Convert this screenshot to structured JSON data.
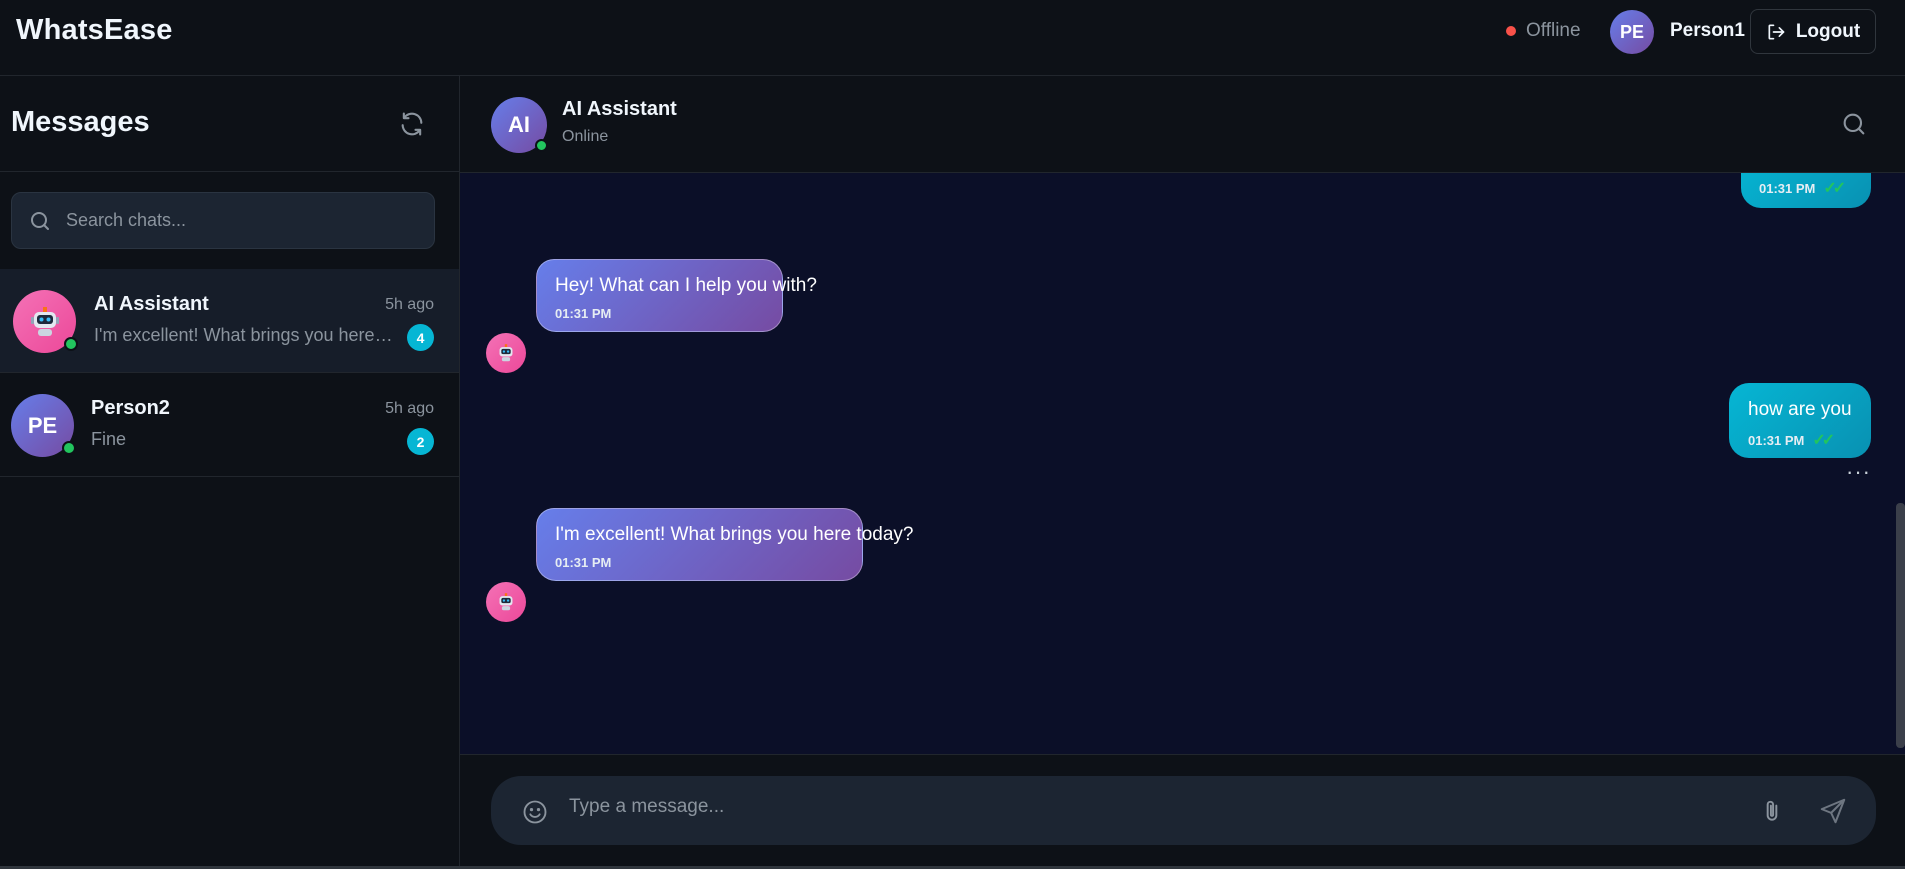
{
  "app": {
    "title": "WhatsEase"
  },
  "header": {
    "status_label": "Offline",
    "status_color": "#f85149",
    "user_initials": "PE",
    "user_name": "Person1",
    "logout_label": "Logout"
  },
  "sidebar": {
    "title": "Messages",
    "search_placeholder": "Search chats...",
    "chats": [
      {
        "name": "AI Assistant",
        "time": "5h ago",
        "preview": "I'm excellent! What brings you here today?",
        "unread": "4",
        "avatar": "robot-icon",
        "online": true,
        "active": true
      },
      {
        "name": "Person2",
        "time": "5h ago",
        "preview": "Fine",
        "unread": "2",
        "avatar_initials": "PE",
        "online": true,
        "active": false
      }
    ]
  },
  "conversation": {
    "contact_initials": "AI",
    "contact_name": "AI Assistant",
    "contact_status": "Online",
    "messages": [
      {
        "direction": "out",
        "text": "",
        "time": "01:31 PM",
        "read": true
      },
      {
        "direction": "in",
        "text": "Hey! What can I help you with?",
        "time": "01:31 PM"
      },
      {
        "direction": "out",
        "text": "how are you",
        "time": "01:31 PM",
        "read": true
      },
      {
        "direction": "in",
        "text": "I'm excellent! What brings you here today?",
        "time": "01:31 PM"
      }
    ],
    "composer_placeholder": "Type a message..."
  },
  "colors": {
    "accent": "#06b6d4",
    "incoming_gradient": [
      "#667eea",
      "#764ba2"
    ],
    "online": "#22c55e"
  }
}
